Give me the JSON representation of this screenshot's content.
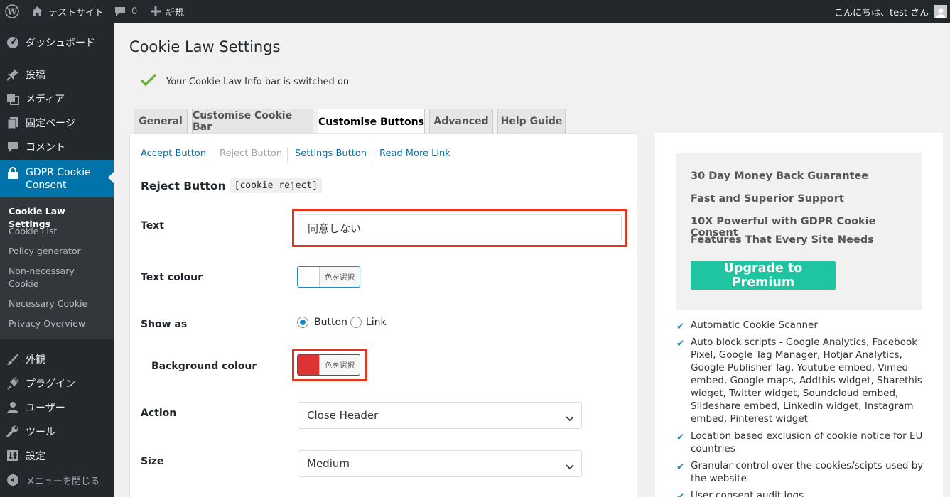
{
  "adminbar": {
    "site_name": "テストサイト",
    "comments_count": "0",
    "new_label": "新規",
    "greeting": "こんにちは、test さん"
  },
  "sidebar": {
    "items": [
      {
        "label": "ダッシュボード",
        "icon": "dashboard-icon"
      },
      {
        "label": "投稿",
        "icon": "pin-icon"
      },
      {
        "label": "メディア",
        "icon": "media-icon"
      },
      {
        "label": "固定ページ",
        "icon": "page-icon"
      },
      {
        "label": "コメント",
        "icon": "comment-icon"
      }
    ],
    "current": {
      "label_line1": "GDPR Cookie",
      "label_line2": "Consent",
      "icon": "lock-icon"
    },
    "submenu": [
      {
        "label": "Cookie Law Settings"
      },
      {
        "label": "Cookie List"
      },
      {
        "label": "Policy generator"
      },
      {
        "label_line1": "Non-necessary",
        "label_line2": "Cookie"
      },
      {
        "label": "Necessary Cookie"
      },
      {
        "label": "Privacy Overview"
      }
    ],
    "items_after": [
      {
        "label": "外観",
        "icon": "brush-icon"
      },
      {
        "label": "プラグイン",
        "icon": "plugin-icon"
      },
      {
        "label": "ユーザー",
        "icon": "user-icon"
      },
      {
        "label": "ツール",
        "icon": "wrench-icon"
      },
      {
        "label": "設定",
        "icon": "settings-icon"
      },
      {
        "label": "メニューを閉じる",
        "icon": "collapse-icon"
      }
    ]
  },
  "main": {
    "title": "Cookie Law Settings",
    "notice": "Your Cookie Law Info bar is switched on",
    "tabs": [
      "General",
      "Customise Cookie Bar",
      "Customise Buttons",
      "Advanced",
      "Help Guide"
    ],
    "subtabs": [
      "Accept Button",
      "Reject Button",
      "Settings Button",
      "Read More Link"
    ],
    "section_title": "Reject Button",
    "section_code": "[cookie_reject]",
    "fields": {
      "text_label": "Text",
      "text_value": "同意しない",
      "text_colour_label": "Text colour",
      "text_colour_value": "#ffffff",
      "choose_colour": "色を選択",
      "show_as_label": "Show as",
      "show_as_options": [
        "Button",
        "Link"
      ],
      "background_colour_label": "Background colour",
      "background_colour_value": "#dd3333",
      "action_label": "Action",
      "action_value": "Close Header",
      "size_label": "Size",
      "size_value": "Medium"
    },
    "highlight_color": "#e8341c"
  },
  "promo": {
    "lines": [
      "30 Day Money Back Guarantee",
      "Fast and Superior Support",
      "10X Powerful with GDPR Cookie Consent",
      "Features That Every Site Needs"
    ],
    "upgrade_label": "Upgrade to Premium",
    "features": [
      "Automatic Cookie Scanner",
      "Auto block scripts - Google Analytics, Facebook Pixel, Google Tag Manager, Hotjar Analytics, Google Publisher Tag, Youtube embed, Vimeo embed, Google maps, Addthis widget, Sharethis widget, Twitter widget, Soundcloud embed, Slideshare embed, Linkedin widget, Instagram embed, Pinterest widget",
      "Location based exclusion of cookie notice for EU countries",
      "Granular control over the cookies/scipts used by the website",
      "User consent audit logs"
    ]
  }
}
